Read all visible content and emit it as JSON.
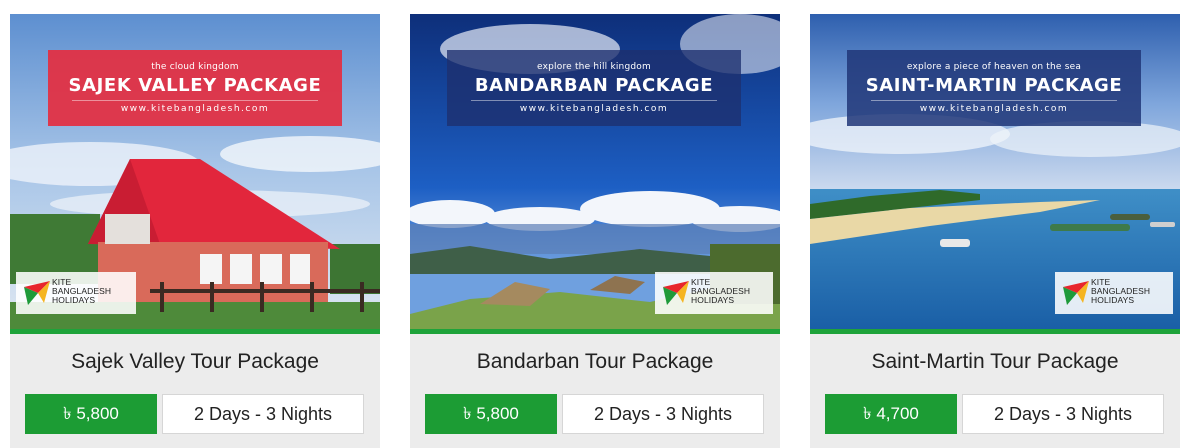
{
  "packages": [
    {
      "banner_sub": "the cloud kingdom",
      "banner_main": "SAJEK VALLEY PACKAGE",
      "banner_url": "www.kitebangladesh.com",
      "title": "Sajek Valley Tour Package",
      "price": "৳ 5,800",
      "duration": "2 Days - 3 Nights"
    },
    {
      "banner_sub": "explore the hill kingdom",
      "banner_main": "BANDARBAN PACKAGE",
      "banner_url": "www.kitebangladesh.com",
      "title": "Bandarban Tour Package",
      "price": "৳ 5,800",
      "duration": "2 Days - 3 Nights"
    },
    {
      "banner_sub": "explore a piece of heaven on the sea",
      "banner_main": "SAINT-MARTIN PACKAGE",
      "banner_url": "www.kitebangladesh.com",
      "title": "Saint-Martin Tour Package",
      "price": "৳ 4,700",
      "duration": "2 Days - 3 Nights"
    }
  ],
  "logo": {
    "line1": "KITE",
    "line2": "BANGLADESH",
    "line3": "HOLIDAYS"
  },
  "colors": {
    "price_bg": "#1c9c34",
    "accent_green": "#1ea33a",
    "sajek_banner": "#e42e40",
    "navy_banner": "#1e306e"
  }
}
